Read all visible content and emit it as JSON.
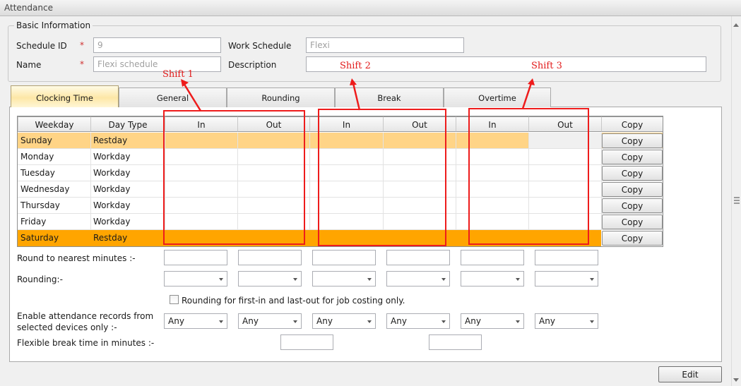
{
  "window": {
    "title": "Attendance"
  },
  "basic": {
    "legend": "Basic Information",
    "schedule_id_label": "Schedule ID",
    "schedule_id_value": "9",
    "name_label": "Name",
    "name_value": "Flexi schedule",
    "required_mark": "*",
    "work_schedule_label": "Work Schedule",
    "work_schedule_value": "Flexi",
    "description_label": "Description",
    "description_value": ""
  },
  "tabs": [
    {
      "label": "Clocking Time",
      "active": true
    },
    {
      "label": "General"
    },
    {
      "label": "Rounding"
    },
    {
      "label": "Break"
    },
    {
      "label": "Overtime"
    }
  ],
  "grid": {
    "headers": [
      "Weekday",
      "Day Type",
      "In",
      "Out",
      "In",
      "Out",
      "In",
      "Out",
      "Copy"
    ],
    "copy_label": "Copy",
    "rows": [
      {
        "weekday": "Sunday",
        "day_type": "Restday",
        "highlight": "restday-light"
      },
      {
        "weekday": "Monday",
        "day_type": "Workday"
      },
      {
        "weekday": "Tuesday",
        "day_type": "Workday"
      },
      {
        "weekday": "Wednesday",
        "day_type": "Workday"
      },
      {
        "weekday": "Thursday",
        "day_type": "Workday"
      },
      {
        "weekday": "Friday",
        "day_type": "Workday"
      },
      {
        "weekday": "Saturday",
        "day_type": "Restday",
        "highlight": "restday-selected"
      }
    ]
  },
  "settings": {
    "round_nearest_label": "Round to nearest minutes :-",
    "rounding_label": "Rounding:-",
    "first_in_last_out_label": "Rounding for first-in and last-out for job costing only.",
    "enable_devices_label_1": "Enable attendance records from",
    "enable_devices_label_2": "selected devices only :-",
    "device_option": "Any",
    "flex_break_label": "Flexible break time in minutes :-"
  },
  "footer": {
    "edit_label": "Edit"
  },
  "annotations": {
    "shift1": "Shift 1",
    "shift2": "Shift 2",
    "shift3": "Shift 3",
    "color": "#ee1c1c"
  },
  "colors": {
    "restday_light": "#ffd486",
    "restday_selected": "#ffa500",
    "tab_active": "#fde7a6"
  }
}
